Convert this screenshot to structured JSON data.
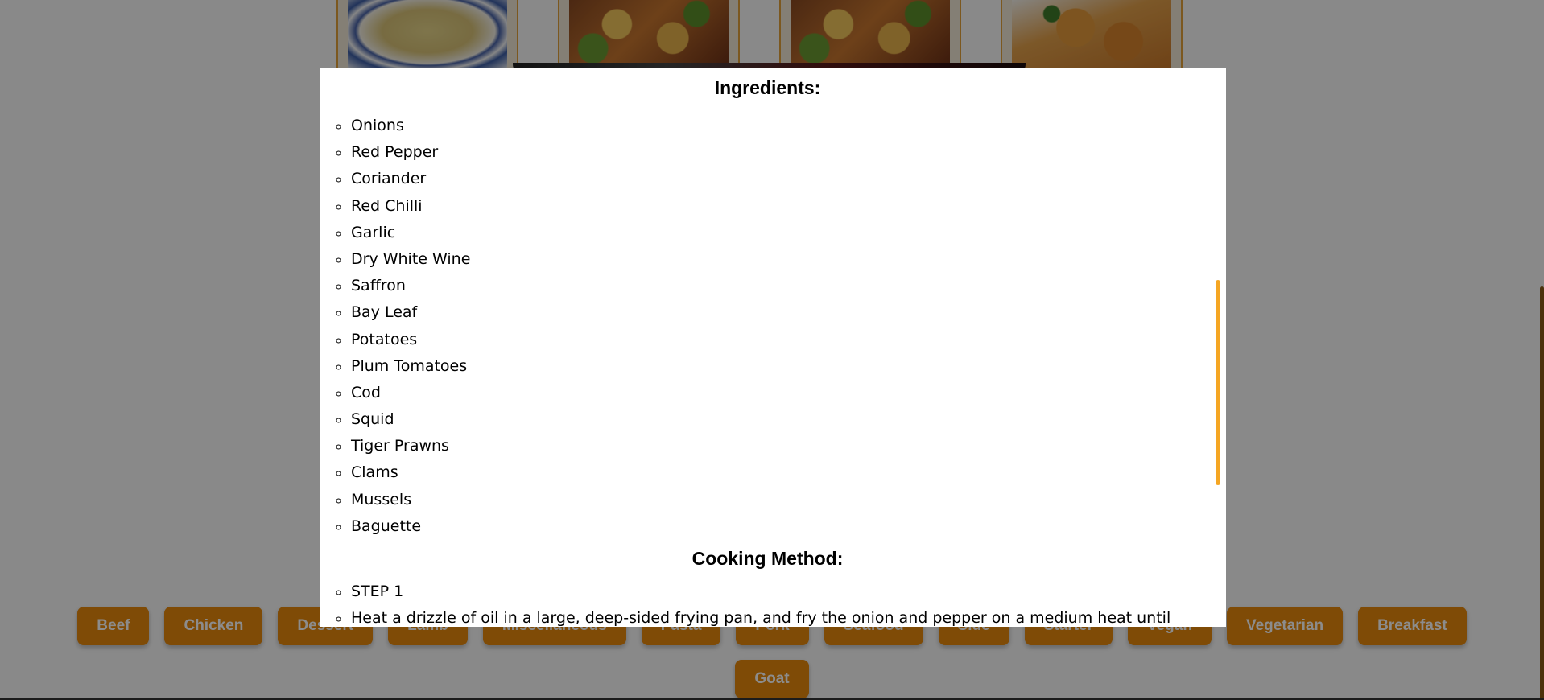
{
  "modal": {
    "ingredients_title": "Ingredients:",
    "ingredients": [
      "Onions",
      "Red Pepper",
      "Coriander",
      "Red Chilli",
      "Garlic",
      "Dry White Wine",
      "Saffron",
      "Bay Leaf",
      "Potatoes",
      "Plum Tomatoes",
      "Cod",
      "Squid",
      "Tiger Prawns",
      "Clams",
      "Mussels",
      "Baguette"
    ],
    "method_title": "Cooking Method:",
    "method_steps": [
      "STEP 1",
      "Heat a drizzle of oil in a large, deep-sided frying pan, and fry the onion and pepper on a medium heat until softened"
    ]
  },
  "categories": {
    "row1": [
      "Beef",
      "Chicken",
      "Dessert",
      "Lamb",
      "Miscellaneous",
      "Pasta",
      "Pork",
      "Seafood",
      "Side",
      "Starter",
      "Vegan",
      "Vegetarian",
      "Breakfast"
    ],
    "row2": [
      "Goat"
    ]
  },
  "colors": {
    "accent": "#e8890c",
    "scrollbar": "#f5a623",
    "thumb_border": "#e2a13a"
  }
}
